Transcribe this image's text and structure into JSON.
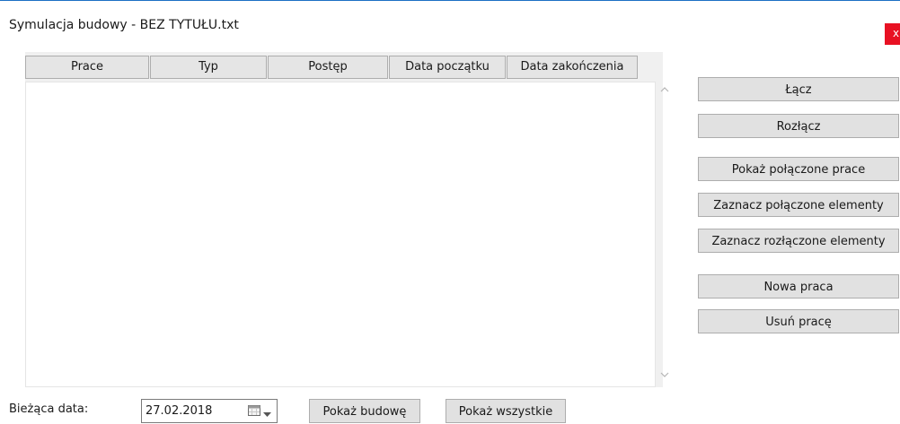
{
  "window": {
    "title": "Symulacja budowy - BEZ TYTUŁU.txt",
    "close_label": "x"
  },
  "table": {
    "columns": [
      "Prace",
      "Typ",
      "Postęp",
      "Data początku",
      "Data zakończenia"
    ],
    "rows": []
  },
  "side_buttons": {
    "connect": "Łącz",
    "disconnect": "Rozłącz",
    "show_connected": "Pokaż połączone prace",
    "select_connected": "Zaznacz połączone elementy",
    "select_disconnected": "Zaznacz rozłączone elementy",
    "new_work": "Nowa praca",
    "delete_work": "Usuń pracę"
  },
  "footer": {
    "date_label": "Bieżąca data:",
    "date_value": "27.02.2018",
    "show_construction": "Pokaż budowę",
    "show_all": "Pokaż wszystkie"
  },
  "icons": {
    "calendar": "calendar-icon",
    "dropdown": "chevron-down-icon",
    "scroll_up": "chevron-up-icon",
    "scroll_down": "chevron-down-icon"
  },
  "colors": {
    "window_border": "#1c6fc4",
    "close_button": "#e81123",
    "button_face": "#e1e1e1",
    "header_face": "#e5e5e5"
  }
}
